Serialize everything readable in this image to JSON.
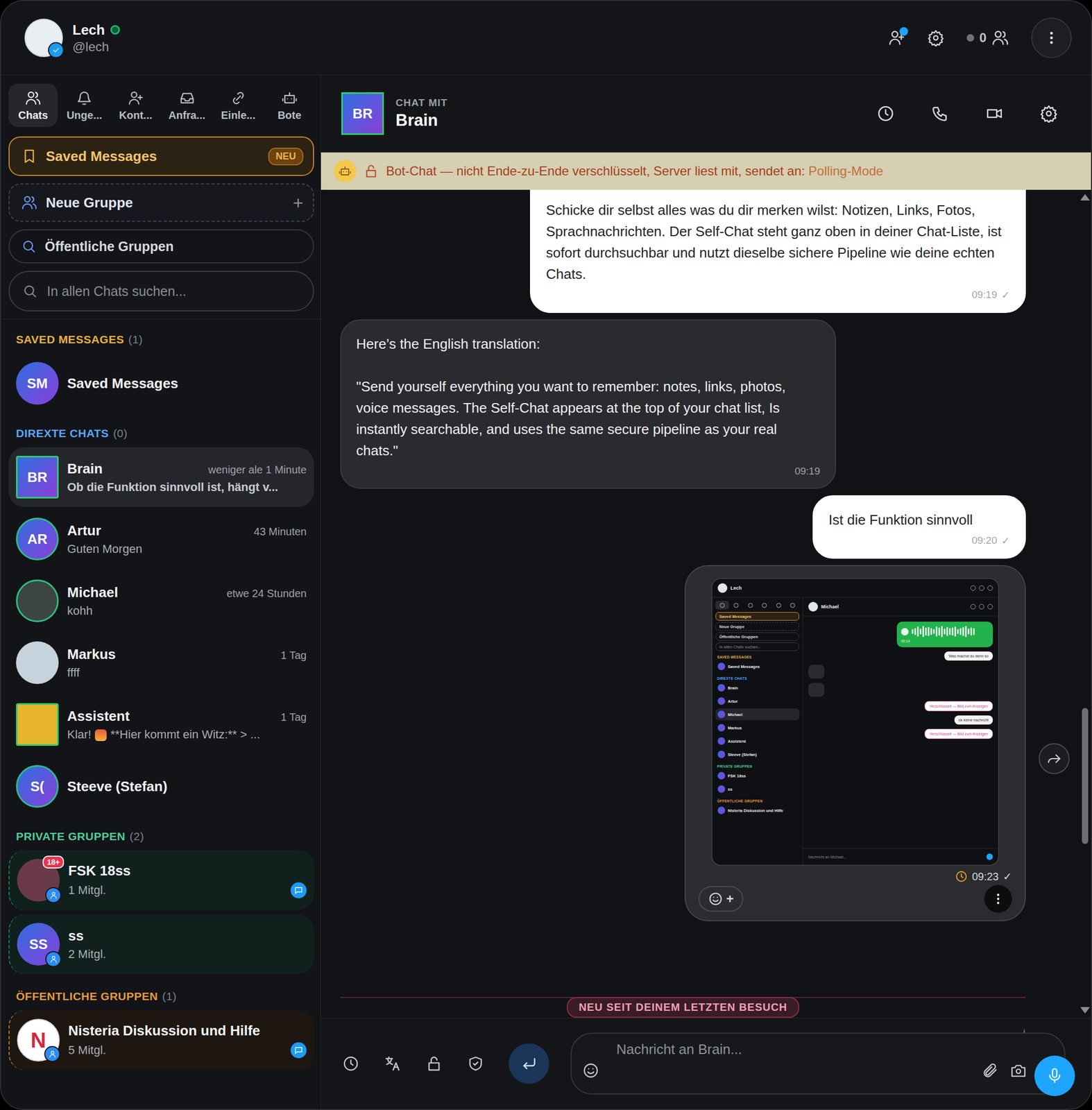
{
  "user": {
    "name": "Lech",
    "handle": "@lech",
    "online": true,
    "verified": true
  },
  "top_bar": {
    "contact_requests": true,
    "online_count": "0"
  },
  "tabs": [
    {
      "label": "Chats",
      "selected": true
    },
    {
      "label": "Unge...",
      "selected": false
    },
    {
      "label": "Kont...",
      "selected": false
    },
    {
      "label": "Anfra...",
      "selected": false
    },
    {
      "label": "Einle...",
      "selected": false
    },
    {
      "label": "Bote",
      "selected": false
    }
  ],
  "sidebar": {
    "saved_button": {
      "label": "Saved Messages",
      "badge": "NEU"
    },
    "new_group": {
      "label": "Neue Gruppe",
      "action": "+"
    },
    "public_groups": {
      "label": "Öffentliche Gruppen"
    },
    "search": {
      "placeholder": "In allen Chats suchen..."
    },
    "sections": [
      {
        "title": "SAVED MESSAGES",
        "count": "(1)",
        "color": "#e8b23a",
        "kind": "plain",
        "items": [
          {
            "name": "Saved Messages",
            "initials": "SM",
            "avatar": "initials",
            "square": false,
            "ring": false,
            "color": "#2f6fe0",
            "selected": false
          }
        ]
      },
      {
        "title": "DIREXTE CHATS",
        "count": "(0)",
        "color": "#5aa7ff",
        "kind": "plain",
        "items": [
          {
            "name": "Brain",
            "initials": "BR",
            "avatar": "initials",
            "square": true,
            "ring": true,
            "color": "#2f6fe0",
            "time": "weniger ale 1 Minute",
            "preview": "Ob die Funktion sinnvoll ist, hängt v...",
            "selected": true
          },
          {
            "name": "Artur",
            "initials": "AR",
            "avatar": "initials",
            "square": false,
            "ring": true,
            "color": "#2f6fe0",
            "time": "43 Minuten",
            "preview": "Guten Morgen",
            "selected": false
          },
          {
            "name": "Michael",
            "avatar": "photo",
            "square": false,
            "ring": true,
            "color": "#3d4541",
            "time": "etwe 24 Stunden",
            "preview": "kohh",
            "selected": false
          },
          {
            "name": "Markus",
            "avatar": "photo",
            "square": false,
            "ring": false,
            "color": "#c6d2dc",
            "time": "1 Tag",
            "preview": "ffff",
            "selected": false
          },
          {
            "name": "Assistent",
            "avatar": "photo",
            "square": true,
            "ring": true,
            "color": "#e8b62c",
            "time": "1 Tag",
            "preview": "Klar!",
            "preview_tail": "**Hier kommt ein Witz:** > ...",
            "selected": false
          },
          {
            "name": "Steeve (Stefan)",
            "initials": "S(",
            "avatar": "initials",
            "square": false,
            "ring": true,
            "color": "#2f6fe0",
            "selected": false
          }
        ]
      },
      {
        "title": "PRIVATE GRUPPEN",
        "count": "(2)",
        "color": "#4ccf9b",
        "kind": "private",
        "items": [
          {
            "name": "FSK 18ss",
            "avatar": "photo",
            "square": false,
            "ring": false,
            "color": "#6b3a4a",
            "badge": "18+",
            "group": true,
            "members": "1 Mitgl.",
            "unread": true,
            "selected": false
          },
          {
            "name": "ss",
            "initials": "SS",
            "avatar": "initials",
            "square": false,
            "ring": false,
            "color": "#2f6fe0",
            "group": true,
            "members": "2 Mitgl.",
            "selected": false
          }
        ]
      },
      {
        "title": "ÖFFENTLICHE GRUPPEN",
        "count": "(1)",
        "color": "#e69a3a",
        "kind": "public",
        "items": [
          {
            "name": "Nisteria Diskussion und Hilfe",
            "initials": "N",
            "avatar": "logo",
            "square": false,
            "ring": false,
            "color": "#ffffff",
            "group": true,
            "members": "5 Mitgl.",
            "unread": true,
            "selected": false
          }
        ]
      }
    ]
  },
  "chat": {
    "label": "CHAT MIT",
    "name": "Brain",
    "initials": "BR"
  },
  "banner": {
    "text": "Bot-Chat — nicht Ende-zu-Ende verschlüsselt, Server liest mit, sendet an:",
    "target": "Polling-Mode"
  },
  "messages": [
    {
      "kind": "text",
      "outgoing": true,
      "cut": true,
      "text": "Schicke dir selbst alles was du dir merken wilst: Notizen, Links, Fotos, Sprachnachrichten. Der Self-Chat steht ganz oben in deiner Chat-Liste, ist sofort durchsuchbar und nutzt dieselbe sichere Pipeline wie deine echten Chats.",
      "time": "09:19",
      "status": "✓"
    },
    {
      "kind": "text",
      "outgoing": false,
      "cut": false,
      "text": "Here’s the English translation:\n\n\"Send yourself everything you want to remember: notes, links, photos, voice messages. The Self-Chat appears at the top of your chat list, Is instantly searchable, and uses the same secure pipeline as your real chats.\"",
      "time": "09:19"
    },
    {
      "kind": "text",
      "outgoing": true,
      "cut": false,
      "text": "Ist die Funktion sinnvoll",
      "time": "09:20",
      "status": "✓"
    },
    {
      "kind": "screenshot",
      "outgoing": true,
      "scheduled": true,
      "time": "09:23",
      "status": "✓",
      "reaction": "+",
      "forward": true
    }
  ],
  "divider": "NEU SEIT DEINEM LETZTEN BESUCH",
  "scrollbar": {
    "level": 0.17,
    "offset": 0.63
  },
  "composer": {
    "placeholder": "Nachricht an Brain..."
  },
  "shot": {
    "user": "Lech",
    "chat_name": "Michael",
    "buttons": [
      {
        "label": "Saved Messages",
        "kind": "saved"
      },
      {
        "label": "Neue Gruppe",
        "kind": "new"
      },
      {
        "label": "Öffentliche Gruppen",
        "kind": "public"
      },
      {
        "label": "In allen Chats suchen...",
        "kind": "search"
      }
    ],
    "sections": [
      {
        "title": "SAVED MESSAGES",
        "color": "#e8b23a",
        "items": [
          {
            "name": "Saved Messages",
            "selected": false
          }
        ]
      },
      {
        "title": "DIREXTE CHATS",
        "color": "#5aa7ff",
        "items": [
          {
            "name": "Brain",
            "selected": false
          },
          {
            "name": "Artur",
            "selected": false
          },
          {
            "name": "Michael",
            "selected": true
          },
          {
            "name": "Markus",
            "selected": false
          },
          {
            "name": "Assistent",
            "selected": false
          },
          {
            "name": "Steeve (Stefan)",
            "selected": false
          }
        ]
      },
      {
        "title": "PRIVATE GRUPPEN",
        "color": "#4ccf9b",
        "items": [
          {
            "name": "FSK 18ss",
            "selected": false
          },
          {
            "name": "ss",
            "selected": false
          }
        ]
      },
      {
        "title": "ÖFFENTLICHE GRUPPEN",
        "color": "#e69a3a",
        "items": [
          {
            "name": "Nisteria Diskussion und Hilfe",
            "selected": false
          }
        ]
      }
    ],
    "messages": [
      {
        "kind": "voice",
        "outgoing": true,
        "time": "00:14",
        "wave": [
          0.3,
          0.5,
          0.8,
          0.4,
          0.9,
          0.6,
          0.7,
          0.5,
          0.3,
          0.8,
          0.6,
          0.9,
          0.4,
          0.7,
          0.5,
          0.6,
          0.8,
          0.3,
          0.5,
          0.7,
          0.9,
          0.4,
          0.6,
          0.5
        ]
      },
      {
        "kind": "plain",
        "outgoing": true,
        "text": "Was machst du denn so"
      },
      {
        "kind": "blank",
        "outgoing": false
      },
      {
        "kind": "blank",
        "outgoing": false
      },
      {
        "kind": "locked",
        "outgoing": true,
        "text": "Verschlüsselt — Bild zum Anzeigen"
      },
      {
        "kind": "plain",
        "outgoing": true,
        "text": "ok keine nachricht"
      },
      {
        "kind": "locked",
        "outgoing": true,
        "text": "Verschlüsselt — Bild zum Anzeigen"
      }
    ],
    "placeholder": "Nachricht an Michael..."
  }
}
